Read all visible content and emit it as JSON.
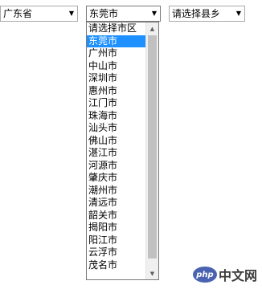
{
  "province_select": {
    "value": "广东省",
    "arrow": "▼"
  },
  "city_select": {
    "value": "东莞市",
    "arrow": "▼",
    "options": [
      "请选择市区",
      "东莞市",
      "广州市",
      "中山市",
      "深圳市",
      "惠州市",
      "江门市",
      "珠海市",
      "汕头市",
      "佛山市",
      "湛江市",
      "河源市",
      "肇庆市",
      "潮州市",
      "清远市",
      "韶关市",
      "揭阳市",
      "阳江市",
      "云浮市",
      "茂名市"
    ],
    "selected_index": 1,
    "scroll_up": "▲",
    "scroll_down": "▼"
  },
  "county_select": {
    "value": "请选择县乡",
    "arrow": "▼"
  },
  "watermark": {
    "badge": "php",
    "text": "中文网"
  },
  "colors": {
    "selected_bg": "#1e90ff",
    "selected_fg": "#ffffff",
    "border": "#a9a9a9",
    "scroll_thumb": "#c1c1c1"
  }
}
